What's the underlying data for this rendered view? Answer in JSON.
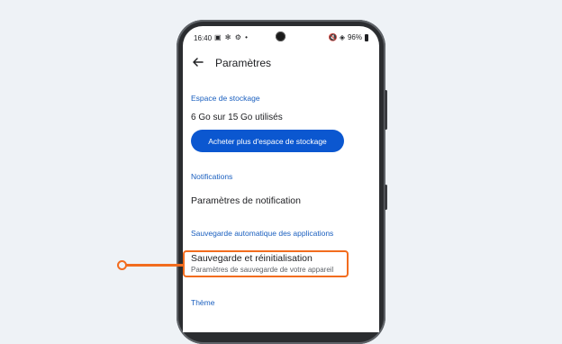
{
  "status_bar": {
    "time": "16:40",
    "left_icons": "▣ ✻ ⚙ •",
    "right_icons": "🔇 ◈",
    "battery": "96%"
  },
  "header": {
    "title": "Paramètres"
  },
  "storage": {
    "section_label": "Espace de stockage",
    "usage": "6 Go sur 15 Go utilisés",
    "button_label": "Acheter plus d'espace de stockage"
  },
  "notifications": {
    "section_label": "Notifications",
    "item_label": "Paramètres de notification"
  },
  "backup": {
    "section_label": "Sauvegarde automatique des applications",
    "item_title": "Sauvegarde et réinitialisation",
    "item_subtitle": "Paramètres de sauvegarde de votre appareil"
  },
  "theme": {
    "section_label": "Thème"
  },
  "colors": {
    "accent_blue": "#0b57d0",
    "section_blue": "#1a5fbf",
    "highlight_orange": "#f26c1e",
    "background": "#eef2f6"
  }
}
